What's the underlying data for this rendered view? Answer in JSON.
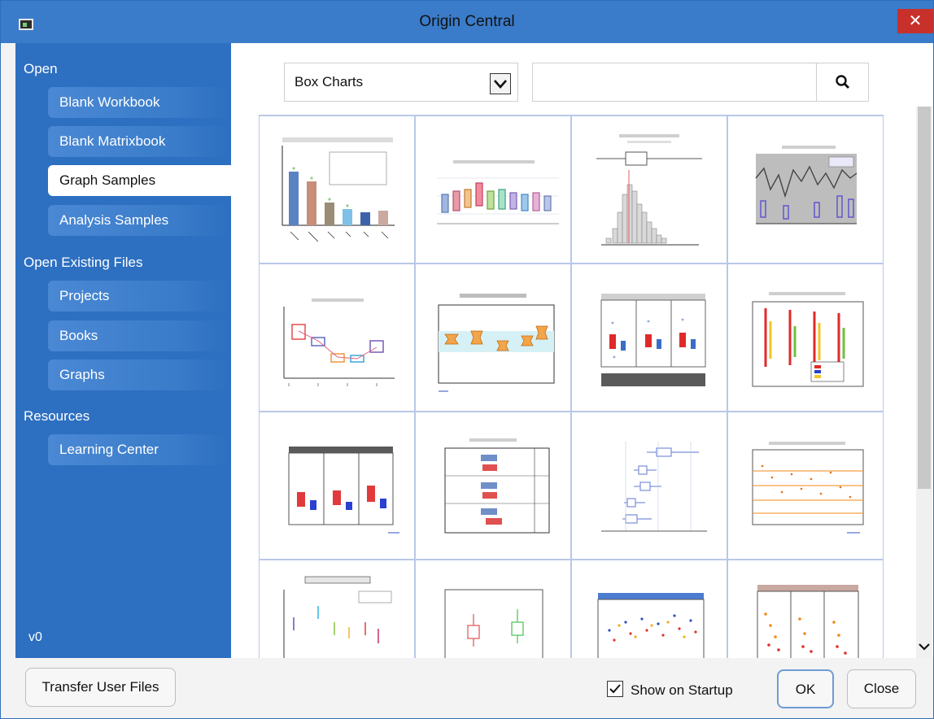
{
  "window": {
    "title": "Origin Central"
  },
  "sidebar": {
    "sections": [
      {
        "label": "Open",
        "items": [
          "Blank Workbook",
          "Blank Matrixbook",
          "Graph Samples",
          "Analysis Samples"
        ]
      },
      {
        "label": "Open Existing Files",
        "items": [
          "Projects",
          "Books",
          "Graphs"
        ]
      },
      {
        "label": "Resources",
        "items": [
          "Learning Center"
        ]
      }
    ],
    "active_item": "Graph Samples",
    "version": "v0"
  },
  "filter": {
    "category_value": "Box Charts",
    "search_value": ""
  },
  "gallery": {
    "tiles": [
      "box-bar-combo",
      "box-multi-color",
      "histogram-box",
      "time-series-box",
      "box-connected-means",
      "notched-box",
      "grouped-box-panels",
      "color-box-legend",
      "panel-box",
      "horizontal-grouped-box",
      "horizontal-box",
      "interval-box",
      "box-labeled-points",
      "two-box",
      "half-violin",
      "scatter-panels"
    ]
  },
  "footer": {
    "transfer_label": "Transfer User Files",
    "show_startup_label": "Show on Startup",
    "show_startup_checked": true,
    "ok_label": "OK",
    "close_label": "Close"
  }
}
